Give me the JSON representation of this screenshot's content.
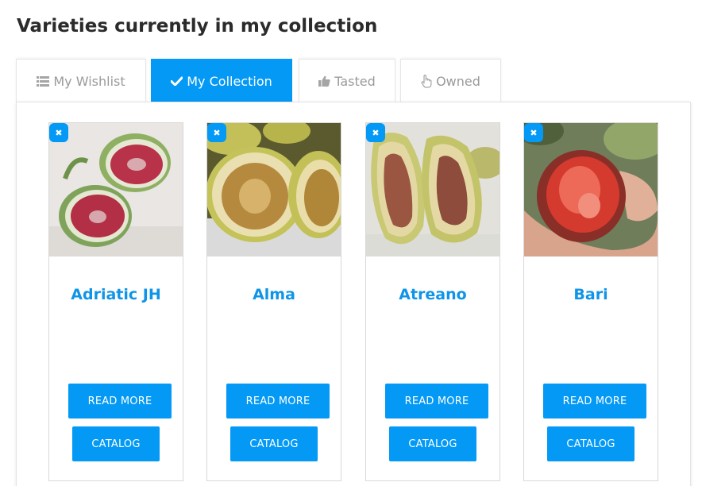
{
  "page": {
    "title": "Varieties currently in my collection"
  },
  "tabs": [
    {
      "label": "My Wishlist",
      "icon": "list-icon",
      "active": false
    },
    {
      "label": "My Collection",
      "icon": "check-icon",
      "active": true
    },
    {
      "label": "Tasted",
      "icon": "thumbs-up-icon",
      "active": false
    },
    {
      "label": "Owned",
      "icon": "hand-pointer-icon",
      "active": false
    }
  ],
  "cards": [
    {
      "name": "Adriatic JH",
      "read_more": "READ MORE",
      "catalog": "CATALOG",
      "remove": "✖"
    },
    {
      "name": "Alma",
      "read_more": "READ MORE",
      "catalog": "CATALOG",
      "remove": "✖"
    },
    {
      "name": "Atreano",
      "read_more": "READ MORE",
      "catalog": "CATALOG",
      "remove": "✖"
    },
    {
      "name": "Bari",
      "read_more": "READ MORE",
      "catalog": "CATALOG",
      "remove": "✖"
    }
  ],
  "colors": {
    "accent": "#0399f5",
    "title_text": "#2b2b2b",
    "card_name": "#0f94e8"
  }
}
